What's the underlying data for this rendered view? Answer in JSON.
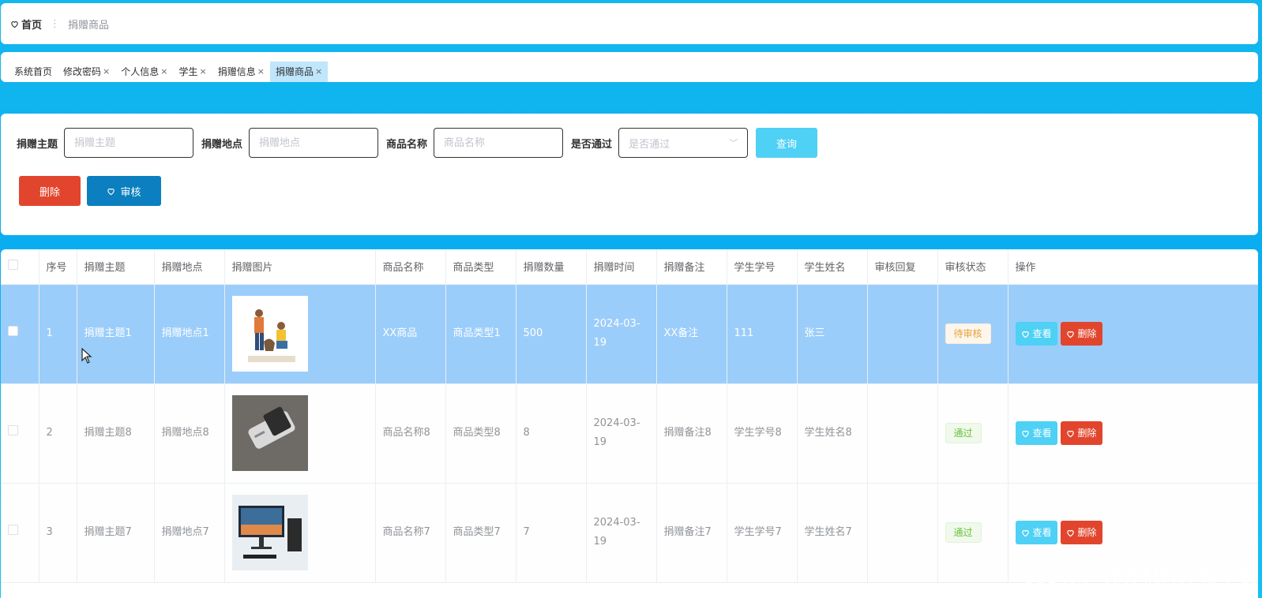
{
  "breadcrumb": {
    "home": "首页",
    "current": "捐赠商品"
  },
  "tabs": [
    {
      "label": "系统首页",
      "closable": false,
      "active": false
    },
    {
      "label": "修改密码",
      "closable": true,
      "active": false
    },
    {
      "label": "个人信息",
      "closable": true,
      "active": false
    },
    {
      "label": "学生",
      "closable": true,
      "active": false
    },
    {
      "label": "捐赠信息",
      "closable": true,
      "active": false
    },
    {
      "label": "捐赠商品",
      "closable": true,
      "active": true
    }
  ],
  "tab_close_glyph": "×",
  "search": {
    "fields": [
      {
        "label": "捐赠主题",
        "placeholder": "捐赠主题"
      },
      {
        "label": "捐赠地点",
        "placeholder": "捐赠地点"
      },
      {
        "label": "商品名称",
        "placeholder": "商品名称"
      }
    ],
    "select": {
      "label": "是否通过",
      "placeholder": "是否通过"
    },
    "query_label": "查询",
    "delete_label": "删除",
    "audit_label": "审核"
  },
  "table": {
    "headers": [
      "序号",
      "捐赠主题",
      "捐赠地点",
      "捐赠图片",
      "商品名称",
      "商品类型",
      "捐赠数量",
      "捐赠时间",
      "捐赠备注",
      "学生学号",
      "学生姓名",
      "审核回复",
      "审核状态",
      "操作"
    ],
    "rows": [
      {
        "index": "1",
        "theme": "捐赠主题1",
        "place": "捐赠地点1",
        "image": "donation-illustration",
        "name": "XX商品",
        "type": "商品类型1",
        "qty": "500",
        "time": "2024-03-19",
        "note": "XX备注",
        "sid": "111",
        "sname": "张三",
        "reply": "",
        "status": "待审核",
        "status_kind": "pending",
        "selected": true
      },
      {
        "index": "2",
        "theme": "捐赠主题8",
        "place": "捐赠地点8",
        "image": "device-photo",
        "name": "商品名称8",
        "type": "商品类型8",
        "qty": "8",
        "time": "2024-03-19",
        "note": "捐赠备注8",
        "sid": "学生学号8",
        "sname": "学生姓名8",
        "reply": "",
        "status": "通过",
        "status_kind": "pass",
        "selected": false
      },
      {
        "index": "3",
        "theme": "捐赠主题7",
        "place": "捐赠地点7",
        "image": "computer-photo",
        "name": "商品名称7",
        "type": "商品类型7",
        "qty": "7",
        "time": "2024-03-19",
        "note": "捐赠备注7",
        "sid": "学生学号7",
        "sname": "学生姓名7",
        "reply": "",
        "status": "通过",
        "status_kind": "pass",
        "selected": false
      }
    ],
    "view_label": "查看",
    "delete_label": "删除"
  },
  "watermark": "CSDN @计算机程序猿学长",
  "colors": {
    "accent": "#4fd0f5",
    "danger": "#e2452d",
    "primary": "#0b7fc0",
    "selected_row": "#9bcdfa"
  }
}
